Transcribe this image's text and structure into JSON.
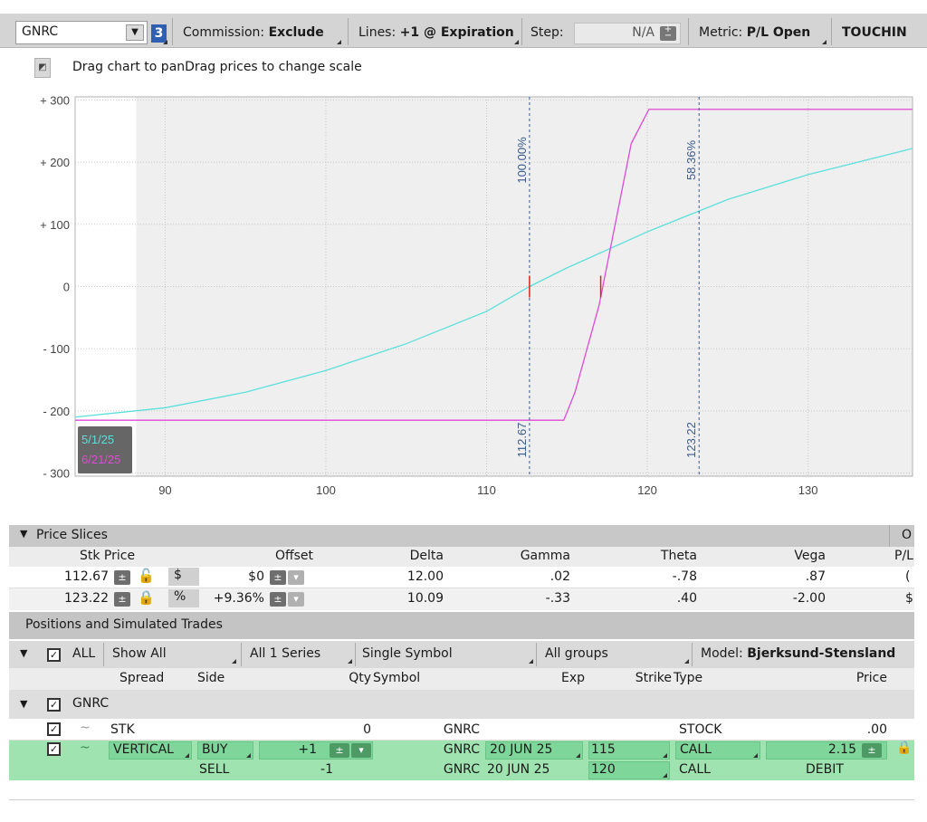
{
  "toolbar": {
    "symbol": "GNRC",
    "link_number": "3",
    "commission_label": "Commission:",
    "commission_value": "Exclude",
    "lines_label": "Lines:",
    "lines_value": "+1 @ Expiration",
    "step_label": "Step:",
    "step_value": "N/A",
    "metric_label": "Metric:",
    "metric_value": "P/L Open",
    "touching_label": "TOUCHIN"
  },
  "hint_text": "Drag chart to panDrag prices to change scale",
  "chart_data": {
    "type": "line",
    "x_ticks": [
      90,
      100,
      110,
      120,
      130
    ],
    "x_tick_labels": [
      "90",
      "100",
      "110",
      "120",
      "130"
    ],
    "y_ticks": [
      300,
      200,
      100,
      0,
      -100,
      -200,
      -300
    ],
    "y_tick_labels": [
      "+ 300",
      "+ 200",
      "+ 100",
      "0",
      "- 100",
      "- 200",
      "- 300"
    ],
    "xlim": [
      84.4,
      136.5
    ],
    "ylim": [
      -305,
      305
    ],
    "series": [
      {
        "name": "5/1/25",
        "color": "#5ce0dc",
        "x": [
          84.4,
          90,
          95,
          100,
          105,
          110,
          112.67,
          115,
          120,
          125,
          130,
          136.5
        ],
        "y": [
          -210,
          -195,
          -170,
          -135,
          -92,
          -40,
          0,
          30,
          88,
          140,
          180,
          222
        ]
      },
      {
        "name": "6/21/25",
        "color": "#e04ad6",
        "x": [
          84.4,
          114.8,
          115.5,
          117,
          119,
          120.1,
          136.5
        ],
        "y": [
          -215,
          -215,
          -170,
          -30,
          230,
          285,
          285
        ]
      }
    ],
    "markers": [
      {
        "price": 112.67,
        "label": "112.67",
        "pct": "100.00%"
      },
      {
        "price": 123.22,
        "label": "123.22",
        "pct": "58.36%"
      }
    ],
    "shade_start": 88.2,
    "legend_position": "bottom-left"
  },
  "price_slices": {
    "title": "Price Slices",
    "right_label": "O",
    "headers": {
      "stk_price": "Stk Price",
      "offset": "Offset",
      "delta": "Delta",
      "gamma": "Gamma",
      "theta": "Theta",
      "vega": "Vega",
      "pl": "P/L"
    },
    "rows": [
      {
        "price": "112.67",
        "mode": "$",
        "offset": "$0",
        "delta": "12.00",
        "gamma": ".02",
        "theta": "-.78",
        "vega": ".87",
        "pl": "("
      },
      {
        "price": "123.22",
        "mode": "%",
        "offset": "+9.36%",
        "delta": "10.09",
        "gamma": "-.33",
        "theta": ".40",
        "vega": "-2.00",
        "pl": "$"
      }
    ]
  },
  "positions": {
    "title": "Positions and Simulated Trades",
    "filter": {
      "all": "ALL",
      "show": "Show All",
      "series": "All 1 Series",
      "symbol": "Single Symbol",
      "groups": "All groups",
      "model_label": "Model:",
      "model_value": "Bjerksund-Stensland"
    },
    "headers": {
      "spread": "Spread",
      "side": "Side",
      "qty": "Qty",
      "symbol": "Symbol",
      "exp": "Exp",
      "strike": "Strike",
      "type": "Type",
      "price": "Price"
    },
    "group": "GNRC",
    "rows": [
      {
        "spread": "STK",
        "side": "",
        "qty": "0",
        "symbol": "GNRC",
        "exp": "",
        "strike": "",
        "type": "STOCK",
        "price": ".00"
      },
      {
        "spread": "VERTICAL",
        "side": "BUY",
        "qty": "+1",
        "symbol": "GNRC",
        "exp": "20 JUN 25",
        "strike": "115",
        "type": "CALL",
        "price": "2.15"
      },
      {
        "spread": "",
        "side": "SELL",
        "qty": "-1",
        "symbol": "GNRC",
        "exp": "20 JUN 25",
        "strike": "120",
        "type": "CALL",
        "price": "DEBIT"
      }
    ]
  }
}
